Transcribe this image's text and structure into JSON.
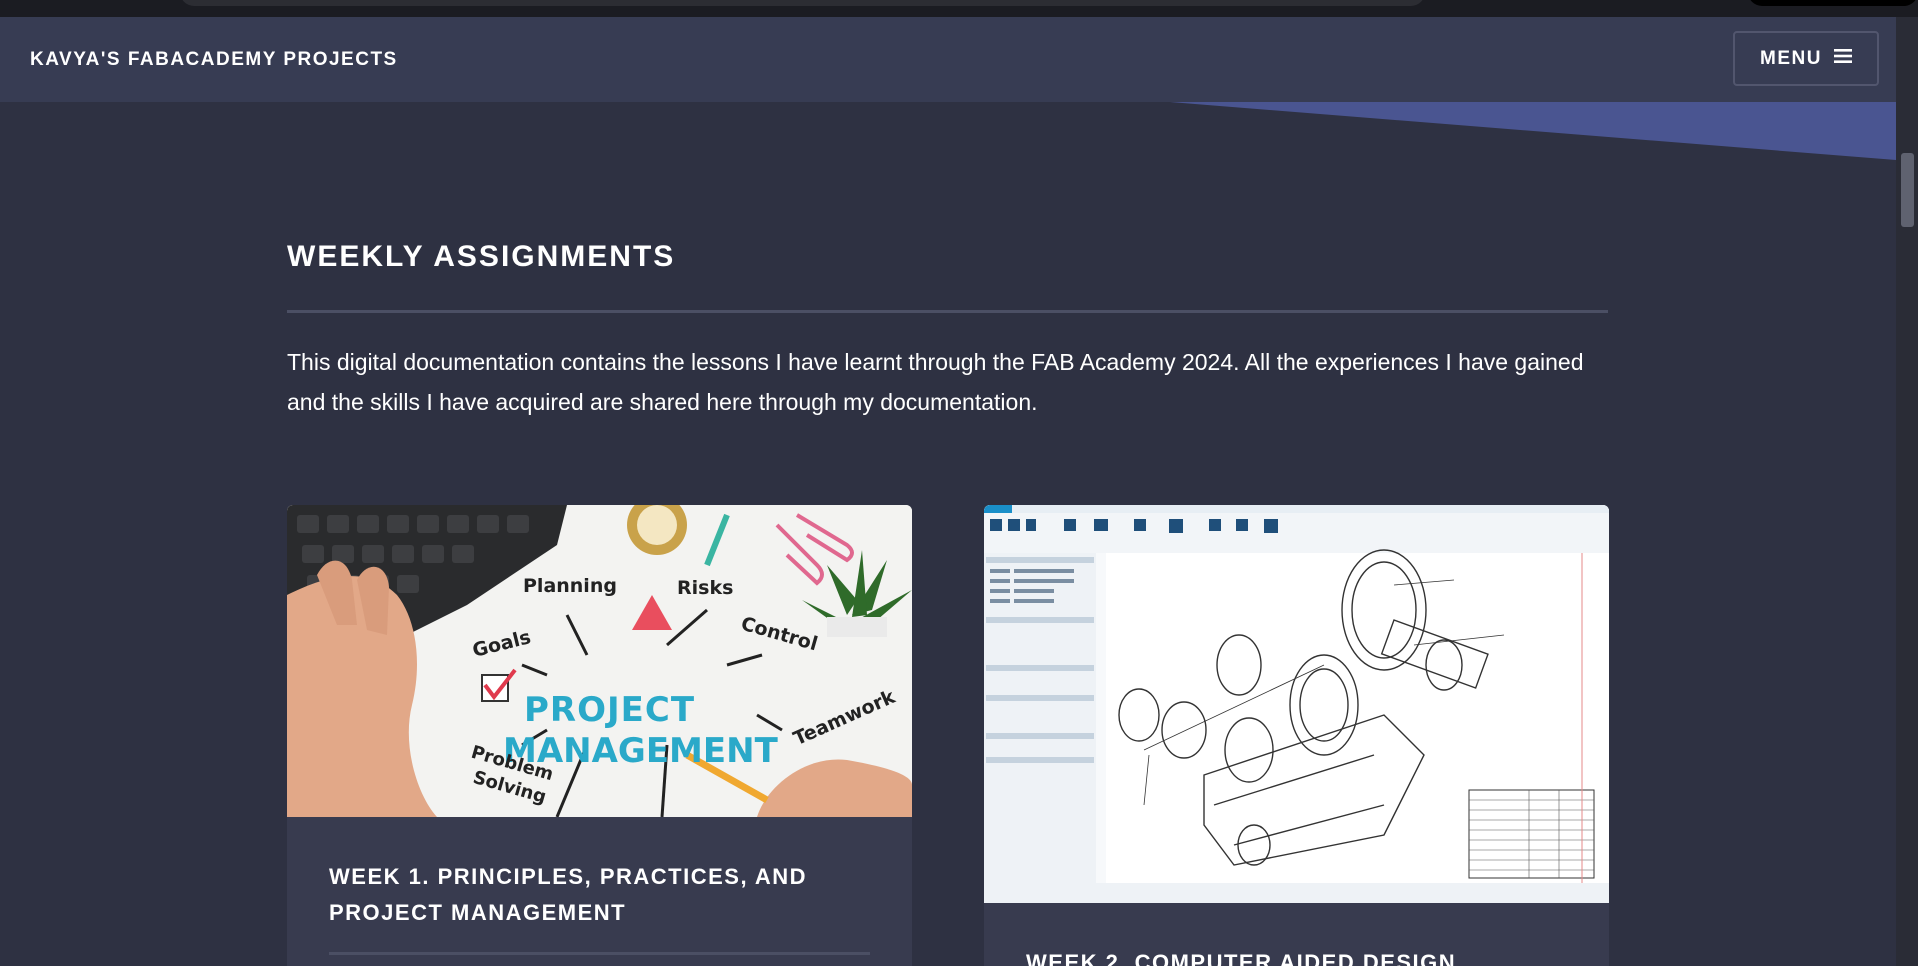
{
  "header": {
    "brand": "KAVYA'S FABACADEMY PROJECTS",
    "menu_label": "MENU"
  },
  "section": {
    "title": "WEEKLY ASSIGNMENTS",
    "intro": "This digital documentation contains the lessons I have learnt through the FAB Academy 2024. All the experiences I have gained and the skills I have acquired are shared here through my documentation."
  },
  "cards": [
    {
      "title": "WEEK 1. PRINCIPLES, PRACTICES, AND PROJECT MANAGEMENT",
      "image_words": {
        "center_line1": "PROJECT",
        "center_line2": "MANAGEMENT",
        "planning": "Planning",
        "risks": "Risks",
        "goals": "Goals",
        "control": "Control",
        "teamwork": "Teamwork",
        "problem": "Problem",
        "solving": "Solving"
      }
    },
    {
      "title": "WEEK 2. COMPUTER AIDED DESIGN"
    }
  ],
  "colors": {
    "background": "#2e3142",
    "header": "#383c54",
    "accent_wedge": "#4a5591",
    "card": "#383b4f",
    "pm_title_blue": "#2aa9c9"
  },
  "icons": [
    "hamburger-icon"
  ]
}
